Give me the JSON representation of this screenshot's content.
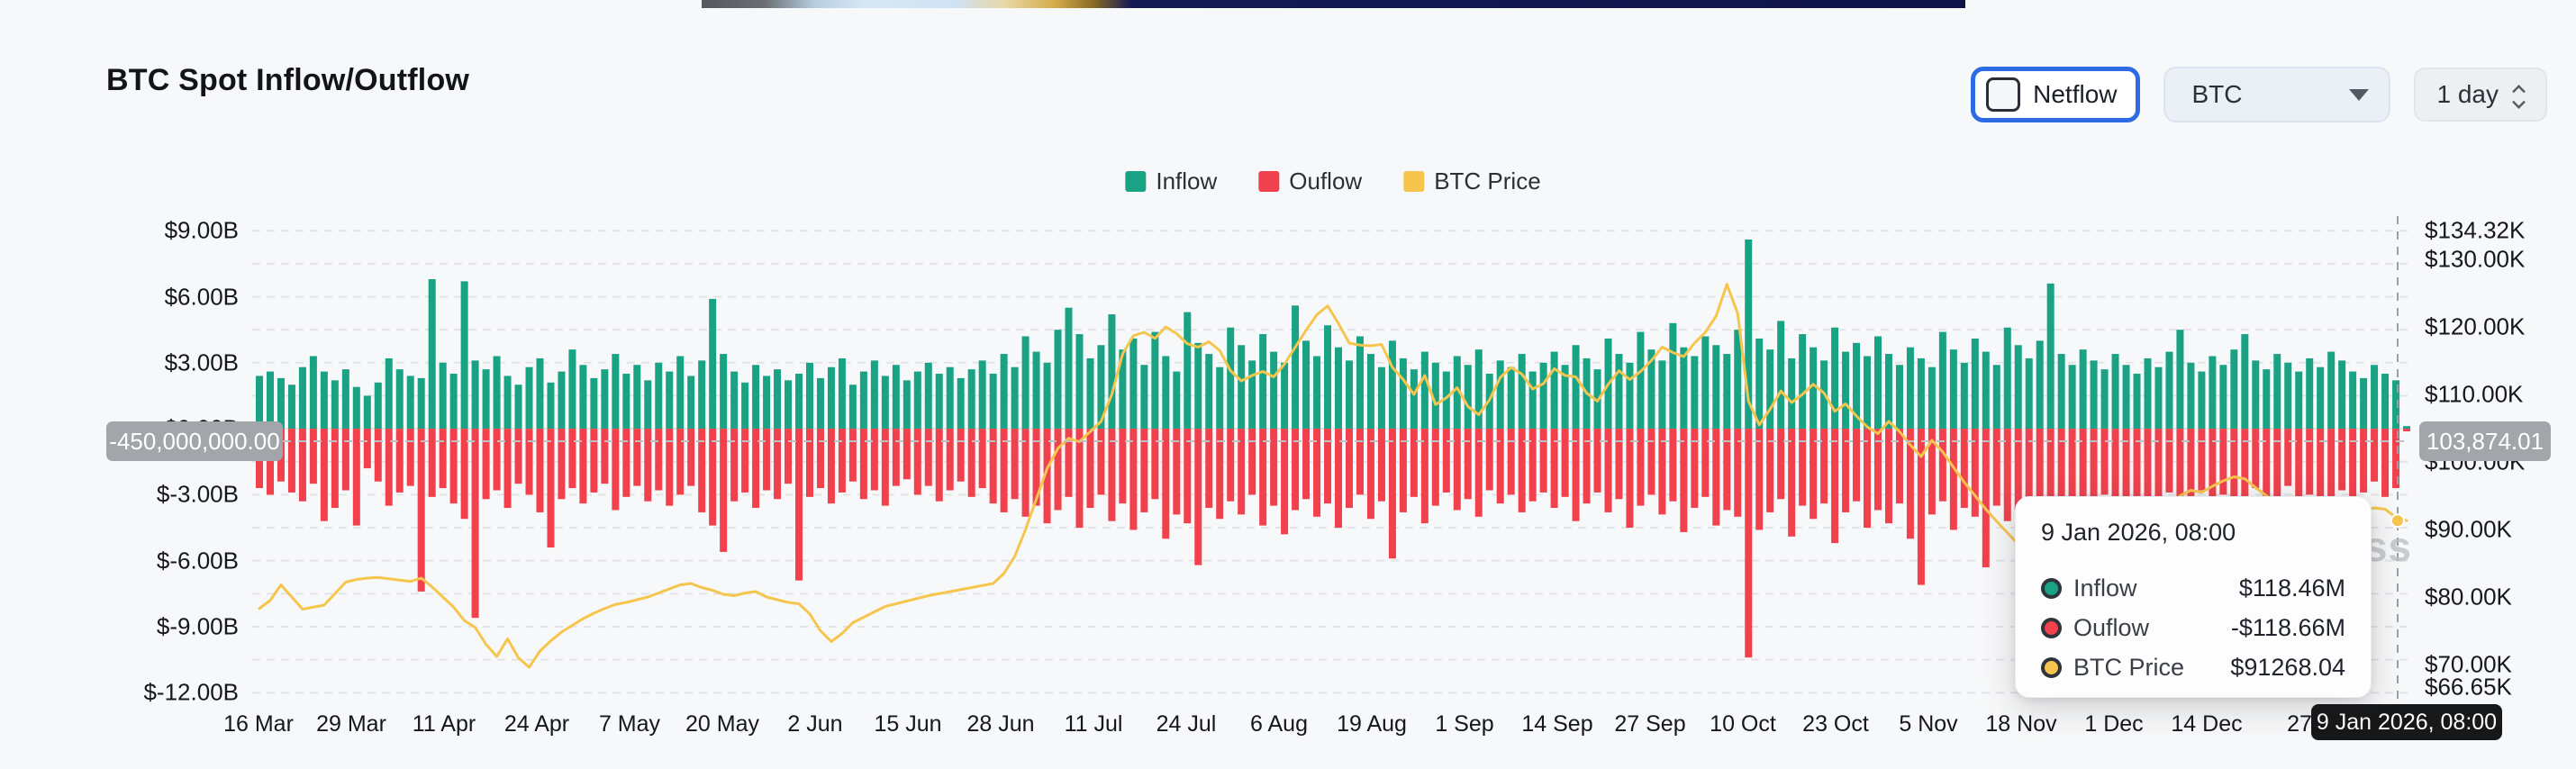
{
  "header": {
    "title": "BTC Spot Inflow/Outflow"
  },
  "controls": {
    "netflow_label": "Netflow",
    "netflow_checked": false,
    "symbol_select": {
      "value": "BTC"
    },
    "interval_stepper": {
      "value": "1 day"
    }
  },
  "legend": [
    {
      "label": "Inflow",
      "color": "#1AA285"
    },
    {
      "label": "Ouflow",
      "color": "#F1414D"
    },
    {
      "label": "BTC Price",
      "color": "#F6C54E"
    }
  ],
  "axes": {
    "left": [
      {
        "text": "$9.00B",
        "value": 9
      },
      {
        "text": "$6.00B",
        "value": 6
      },
      {
        "text": "$3.00B",
        "value": 3
      },
      {
        "text": "$0.00B",
        "value": 0
      },
      {
        "text": "$-3.00B",
        "value": -3
      },
      {
        "text": "$-6.00B",
        "value": -6
      },
      {
        "text": "$-9.00B",
        "value": -9
      },
      {
        "text": "$-12.00B",
        "value": -12
      }
    ],
    "right": [
      {
        "text": "$134.32K",
        "value": 134.32
      },
      {
        "text": "$130.00K",
        "value": 130
      },
      {
        "text": "$120.00K",
        "value": 120
      },
      {
        "text": "$110.00K",
        "value": 110
      },
      {
        "text": "$100.00K",
        "value": 100
      },
      {
        "text": "$90.00K",
        "value": 90
      },
      {
        "text": "$80.00K",
        "value": 80
      },
      {
        "text": "$70.00K",
        "value": 70
      },
      {
        "text": "$66.65K",
        "value": 66.65
      }
    ],
    "x": [
      "16 Mar",
      "29 Mar",
      "11 Apr",
      "24 Apr",
      "7 May",
      "20 May",
      "2 Jun",
      "15 Jun",
      "28 Jun",
      "11 Jul",
      "24 Jul",
      "6 Aug",
      "19 Aug",
      "1 Sep",
      "14 Sep",
      "27 Sep",
      "10 Oct",
      "23 Oct",
      "5 Nov",
      "18 Nov",
      "1 Dec",
      "14 Dec",
      "27"
    ]
  },
  "crosshair": {
    "left_value": "-450,000,000.00",
    "right_value": "103,874.01",
    "x_value": "9 Jan 2026, 08:00"
  },
  "tooltip": {
    "title": "9 Jan 2026, 08:00",
    "rows": [
      {
        "label": "Inflow",
        "value": "$118.46M",
        "color": "#1AA285"
      },
      {
        "label": "Ouflow",
        "value": "-$118.66M",
        "color": "#F1414D"
      },
      {
        "label": "BTC Price",
        "value": "$91268.04",
        "color": "#F6C54E"
      }
    ]
  },
  "watermark": "coinglass",
  "chart_data": {
    "type": "combo",
    "subtype": "bars+line",
    "title": "BTC Spot Inflow/Outflow",
    "x_axis": {
      "start": "16 Mar",
      "end": "9 Jan 2026, 08:00",
      "interval": "1 day",
      "tick_labels": [
        "16 Mar",
        "29 Mar",
        "11 Apr",
        "24 Apr",
        "7 May",
        "20 May",
        "2 Jun",
        "15 Jun",
        "28 Jun",
        "11 Jul",
        "24 Jul",
        "6 Aug",
        "19 Aug",
        "1 Sep",
        "14 Sep",
        "27 Sep",
        "10 Oct",
        "23 Oct",
        "5 Nov",
        "18 Nov",
        "1 Dec",
        "14 Dec",
        "27"
      ]
    },
    "ylim_left_billions": [
      -12,
      9
    ],
    "ylim_right_thousands": [
      66.65,
      134.32
    ],
    "grid": "horizontal-dashed",
    "legend_position": "top-center",
    "series": [
      {
        "name": "Inflow",
        "type": "bar",
        "unit": "$B",
        "color": "#1AA285",
        "values": [
          2.4,
          2.6,
          2.3,
          2.0,
          2.8,
          3.3,
          2.6,
          2.2,
          2.7,
          1.9,
          1.5,
          2.1,
          3.2,
          2.7,
          2.4,
          2.3,
          6.8,
          3.0,
          2.5,
          6.7,
          3.1,
          2.7,
          3.3,
          2.4,
          2.0,
          2.8,
          3.2,
          2.1,
          2.6,
          3.6,
          2.9,
          2.3,
          2.7,
          3.4,
          2.5,
          2.9,
          2.2,
          3.0,
          2.6,
          3.3,
          2.4,
          3.1,
          5.9,
          3.4,
          2.6,
          2.1,
          2.9,
          2.4,
          2.7,
          2.2,
          2.5,
          3.0,
          2.3,
          2.8,
          3.2,
          2.0,
          2.6,
          3.1,
          2.4,
          2.9,
          2.2,
          2.6,
          3.0,
          2.5,
          2.8,
          2.3,
          2.7,
          3.1,
          2.5,
          3.4,
          2.8,
          4.2,
          3.5,
          3.0,
          4.5,
          5.5,
          4.3,
          3.2,
          3.8,
          5.2,
          3.6,
          4.1,
          2.9,
          4.4,
          3.3,
          2.6,
          5.3,
          3.9,
          3.4,
          2.8,
          4.6,
          3.8,
          3.1,
          4.3,
          3.5,
          3.0,
          5.6,
          4.0,
          3.3,
          4.7,
          3.7,
          3.1,
          4.2,
          3.4,
          2.8,
          4.0,
          3.2,
          2.7,
          3.5,
          3.0,
          2.6,
          3.3,
          2.9,
          3.6,
          2.5,
          3.1,
          2.8,
          3.4,
          2.6,
          3.0,
          3.5,
          2.9,
          3.8,
          3.2,
          2.7,
          4.1,
          3.4,
          3.0,
          4.4,
          3.6,
          3.1,
          4.8,
          3.7,
          3.3,
          4.2,
          3.8,
          3.4,
          4.5,
          8.6,
          4.1,
          3.6,
          4.9,
          3.2,
          4.3,
          3.7,
          3.1,
          4.6,
          3.5,
          3.9,
          3.3,
          4.2,
          3.4,
          2.9,
          3.7,
          3.2,
          2.8,
          4.4,
          3.6,
          3.0,
          4.1,
          3.5,
          2.9,
          4.6,
          3.8,
          3.2,
          4.0,
          6.6,
          3.4,
          2.9,
          3.6,
          3.1,
          2.7,
          3.4,
          2.9,
          2.5,
          3.2,
          2.8,
          3.5,
          4.5,
          3.0,
          2.6,
          3.3,
          2.9,
          3.6,
          4.3,
          3.1,
          2.7,
          3.4,
          3.0,
          2.6,
          3.2,
          2.8,
          3.5,
          3.1,
          2.6,
          2.3,
          2.9,
          2.5,
          2.2,
          0.118
        ]
      },
      {
        "name": "Ouflow",
        "type": "bar",
        "unit": "$B",
        "color": "#F1414D",
        "values": [
          -2.7,
          -3.0,
          -2.4,
          -2.9,
          -3.3,
          -2.5,
          -4.2,
          -3.6,
          -2.8,
          -4.4,
          -1.8,
          -2.4,
          -3.5,
          -2.9,
          -2.6,
          -7.4,
          -3.1,
          -2.7,
          -3.4,
          -4.1,
          -8.6,
          -3.2,
          -2.8,
          -3.6,
          -2.5,
          -3.0,
          -3.8,
          -5.4,
          -3.2,
          -2.7,
          -3.4,
          -2.9,
          -2.5,
          -3.7,
          -3.1,
          -2.6,
          -3.3,
          -2.8,
          -3.5,
          -3.0,
          -2.6,
          -3.8,
          -4.4,
          -5.6,
          -3.3,
          -2.9,
          -3.6,
          -2.8,
          -3.2,
          -2.5,
          -6.9,
          -3.1,
          -2.7,
          -3.4,
          -2.9,
          -2.4,
          -3.2,
          -2.8,
          -3.5,
          -2.6,
          -2.3,
          -3.0,
          -2.6,
          -3.3,
          -2.8,
          -2.4,
          -3.1,
          -2.7,
          -3.4,
          -3.8,
          -3.2,
          -4.0,
          -3.5,
          -4.3,
          -3.7,
          -3.1,
          -4.5,
          -3.6,
          -3.0,
          -4.2,
          -3.4,
          -4.6,
          -3.8,
          -3.2,
          -5.0,
          -3.9,
          -4.3,
          -6.2,
          -3.6,
          -4.1,
          -3.3,
          -3.9,
          -3.0,
          -4.4,
          -3.5,
          -4.8,
          -3.7,
          -3.2,
          -4.0,
          -3.4,
          -4.5,
          -3.6,
          -3.0,
          -4.1,
          -3.3,
          -5.9,
          -3.8,
          -3.1,
          -4.3,
          -3.5,
          -2.9,
          -3.7,
          -3.2,
          -4.0,
          -2.8,
          -3.4,
          -3.0,
          -3.8,
          -3.3,
          -2.9,
          -3.6,
          -3.1,
          -4.2,
          -3.4,
          -2.9,
          -3.8,
          -3.2,
          -4.5,
          -3.5,
          -3.0,
          -3.9,
          -3.3,
          -4.7,
          -3.6,
          -3.1,
          -4.4,
          -3.7,
          -4.0,
          -10.4,
          -4.6,
          -3.8,
          -3.2,
          -4.9,
          -3.5,
          -4.1,
          -3.4,
          -5.2,
          -3.8,
          -3.3,
          -4.5,
          -3.7,
          -4.3,
          -3.4,
          -5.0,
          -7.1,
          -3.9,
          -3.3,
          -4.6,
          -3.6,
          -4.0,
          -6.3,
          -3.5,
          -4.2,
          -3.7,
          -3.1,
          -4.4,
          -6.5,
          -3.8,
          -3.2,
          -4.1,
          -3.5,
          -3.0,
          -6.9,
          -3.6,
          -3.1,
          -4.2,
          -3.4,
          -2.9,
          -3.8,
          -3.3,
          -2.8,
          -3.5,
          -3.0,
          -3.9,
          -3.2,
          -2.7,
          -3.6,
          -3.1,
          -2.6,
          -3.4,
          -3.0,
          -3.7,
          -3.2,
          -2.8,
          -3.5,
          -2.9,
          -2.4,
          -3.1,
          -2.7,
          -0.119
        ]
      },
      {
        "name": "BTC Price",
        "type": "line",
        "unit": "$K",
        "color": "#F6C54E",
        "values": [
          78.3,
          79.5,
          81.8,
          80.0,
          78.2,
          78.5,
          78.8,
          80.5,
          82.2,
          82.6,
          82.8,
          82.9,
          82.7,
          82.5,
          82.3,
          82.8,
          81.5,
          80.0,
          78.5,
          76.5,
          75.5,
          73.0,
          71.2,
          73.8,
          71.0,
          69.6,
          72.0,
          73.5,
          74.8,
          75.8,
          76.8,
          77.6,
          78.3,
          78.9,
          79.2,
          79.6,
          80.0,
          80.6,
          81.2,
          81.8,
          82.0,
          81.4,
          81.0,
          80.4,
          80.2,
          80.6,
          80.8,
          80.0,
          79.6,
          79.2,
          79.0,
          77.5,
          75.0,
          73.4,
          74.6,
          76.2,
          77.0,
          77.8,
          78.6,
          79.0,
          79.4,
          79.8,
          80.2,
          80.5,
          80.8,
          81.1,
          81.4,
          81.7,
          82.0,
          83.5,
          86.0,
          90.0,
          94.5,
          99.0,
          102.0,
          103.5,
          103.0,
          104.5,
          106.0,
          110.0,
          116.0,
          118.7,
          119.2,
          118.3,
          120.0,
          119.0,
          117.5,
          117.0,
          117.8,
          116.5,
          113.5,
          112.0,
          112.8,
          113.4,
          112.6,
          114.5,
          117.0,
          119.5,
          121.8,
          123.1,
          120.5,
          117.6,
          117.3,
          117.2,
          117.4,
          114.0,
          112.2,
          110.0,
          112.8,
          108.5,
          109.5,
          111.0,
          108.2,
          107.0,
          109.2,
          112.5,
          114.0,
          113.0,
          110.8,
          111.6,
          113.8,
          112.8,
          112.6,
          110.2,
          109.0,
          111.5,
          113.5,
          112.2,
          113.4,
          115.0,
          117.0,
          116.2,
          115.6,
          117.6,
          119.2,
          121.6,
          126.3,
          122.0,
          109.0,
          105.5,
          107.8,
          110.5,
          108.8,
          110.0,
          111.5,
          110.2,
          107.5,
          108.6,
          106.8,
          105.2,
          104.2,
          106.0,
          104.5,
          102.5,
          100.8,
          103.2,
          101.5,
          99.2,
          97.0,
          95.0,
          93.0,
          91.2,
          89.5,
          87.8,
          86.5,
          85.6,
          84.8,
          86.2,
          88.0,
          89.8,
          90.6,
          88.4,
          86.5,
          87.6,
          89.0,
          90.8,
          92.2,
          93.6,
          95.0,
          95.8,
          95.5,
          96.4,
          97.2,
          97.8,
          97.5,
          96.2,
          95.0,
          93.8,
          93.0,
          93.6,
          94.5,
          93.8,
          92.6,
          91.5,
          92.0,
          92.8,
          93.2,
          93.0,
          91.8,
          91.3
        ]
      }
    ]
  }
}
